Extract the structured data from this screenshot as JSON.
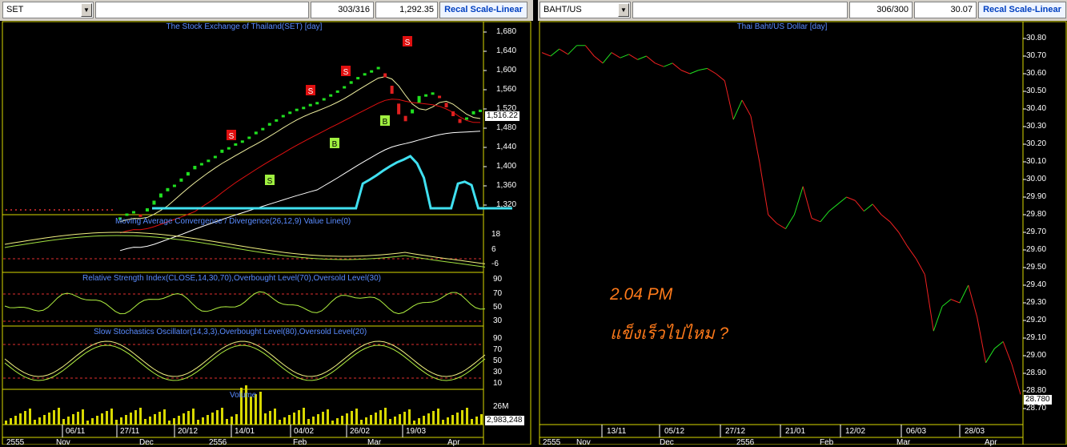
{
  "left": {
    "symbol": "SET",
    "counter": "303/316",
    "value": "1,292.35",
    "button": "Recal Scale-Linear",
    "main_title": "The Stock Exchange of Thailand(SET) [day]",
    "last_value": "1,516.22",
    "y_ticks": [
      "1,680",
      "1,640",
      "1,600",
      "1,560",
      "1,520",
      "1,480",
      "1,440",
      "1,400",
      "1,360",
      "1,320"
    ],
    "macd_title": "Moving Average Convergence / Divergence(26,12,9) Value Line(0)",
    "macd_ticks": [
      "18",
      "6",
      "-6"
    ],
    "rsi_title": "Relative Strength Index(CLOSE,14,30,70),Overbought Level(70),Oversold Level(30)",
    "rsi_ticks": [
      "90",
      "70",
      "50",
      "30"
    ],
    "stoch_title": "Slow Stochastics Oscillator(14,3,3),Overbought Level(80),Oversold Level(20)",
    "stoch_ticks": [
      "90",
      "70",
      "50",
      "30",
      "10"
    ],
    "volume_title": "Volume",
    "volume_tick": "26M",
    "volume_value": "2,983,248",
    "x_ticks": [
      "06/11",
      "27/11",
      "20/12",
      "14/01",
      "04/02",
      "26/02",
      "19/03"
    ],
    "x_ticks2": [
      "2555",
      "Nov",
      "Dec",
      "2556",
      "Feb",
      "Mar",
      "Apr"
    ],
    "signals": [
      "S",
      "S",
      "S",
      "S",
      "S",
      "B",
      "B",
      "B"
    ]
  },
  "right": {
    "symbol": "BAHT/US",
    "counter": "306/300",
    "value": "30.07",
    "button": "Recal Scale-Linear",
    "main_title": "Thai Baht/US Dollar [day]",
    "last_value": "28.780",
    "y_ticks": [
      "30.80",
      "30.70",
      "30.60",
      "30.50",
      "30.40",
      "30.30",
      "30.20",
      "30.10",
      "30.00",
      "29.90",
      "29.80",
      "29.70",
      "29.60",
      "29.50",
      "29.40",
      "29.30",
      "29.20",
      "29.10",
      "29.00",
      "28.90",
      "28.80",
      "28.70"
    ],
    "x_ticks": [
      "13/11",
      "05/12",
      "27/12",
      "21/01",
      "12/02",
      "06/03",
      "28/03"
    ],
    "x_ticks2": [
      "2555",
      "Nov",
      "Dec",
      "2556",
      "Feb",
      "Mar",
      "Apr"
    ],
    "annotation_time": "2.04 PM",
    "annotation_text": "แข็งเร็วไปไหม ?"
  },
  "chart_data": [
    {
      "type": "line",
      "title": "The Stock Exchange of Thailand(SET) [day]",
      "ylim": [
        1300,
        1700
      ],
      "series": [
        {
          "name": "SET",
          "values": [
            1292,
            1300,
            1305,
            1298,
            1310,
            1325,
            1340,
            1352,
            1360,
            1372,
            1385,
            1398,
            1405,
            1412,
            1420,
            1432,
            1438,
            1446,
            1452,
            1460,
            1470,
            1478,
            1488,
            1496,
            1505,
            1512,
            1518,
            1522,
            1528,
            1532,
            1540,
            1548,
            1556,
            1565,
            1575,
            1584,
            1592,
            1598,
            1605,
            1590,
            1560,
            1520,
            1500,
            1515,
            1540,
            1548,
            1552,
            1545,
            1528,
            1510,
            1495,
            1500,
            1512,
            1516
          ]
        }
      ],
      "last": 1516.22
    },
    {
      "type": "line",
      "title": "Thai Baht/US Dollar [day]",
      "ylim": [
        28.7,
        30.85
      ],
      "series": [
        {
          "name": "THB/USD",
          "values": [
            30.72,
            30.7,
            30.74,
            30.71,
            30.76,
            30.76,
            30.7,
            30.66,
            30.72,
            30.69,
            30.71,
            30.68,
            30.7,
            30.66,
            30.64,
            30.66,
            30.62,
            30.6,
            30.62,
            30.63,
            30.6,
            30.56,
            30.34,
            30.45,
            30.36,
            30.1,
            29.8,
            29.75,
            29.72,
            29.8,
            29.96,
            29.78,
            29.76,
            29.82,
            29.86,
            29.9,
            29.88,
            29.82,
            29.86,
            29.8,
            29.76,
            29.7,
            29.62,
            29.55,
            29.46,
            29.14,
            29.28,
            29.32,
            29.3,
            29.4,
            29.22,
            28.96,
            29.04,
            29.08,
            28.95,
            28.78
          ]
        }
      ],
      "last": 28.78
    }
  ]
}
